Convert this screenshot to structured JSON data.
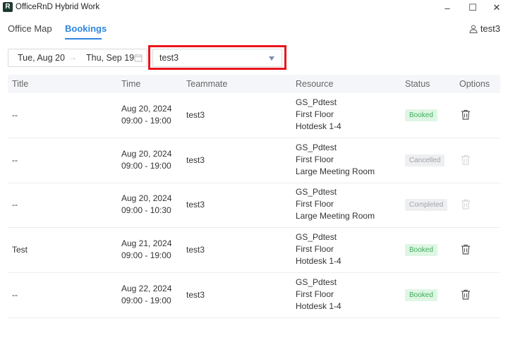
{
  "window": {
    "title": "OfficeRnD Hybrid Work",
    "logo_letter": "R",
    "min_label": "–",
    "max_label": "☐",
    "close_label": "✕"
  },
  "nav": {
    "tabs": [
      "Office Map",
      "Bookings"
    ],
    "active": "Bookings"
  },
  "user": {
    "name": "test3",
    "icon": "user-icon"
  },
  "filters": {
    "date_start": "Tue, Aug 20",
    "date_arrow": "→",
    "date_end": "Thu, Sep 19",
    "teammate_selected": "test3"
  },
  "table": {
    "columns": [
      "Title",
      "Time",
      "Teammate",
      "Resource",
      "Status",
      "Options"
    ],
    "rows": [
      {
        "title": "--",
        "date": "Aug 20, 2024",
        "time": "09:00 - 19:00",
        "teammate": "test3",
        "resource": [
          "GS_Pdtest",
          "First Floor",
          "Hotdesk 1-4"
        ],
        "status": "Booked",
        "delete_enabled": true
      },
      {
        "title": "--",
        "date": "Aug 20, 2024",
        "time": "09:00 - 19:00",
        "teammate": "test3",
        "resource": [
          "GS_Pdtest",
          "First Floor",
          "Large Meeting Room"
        ],
        "status": "Cancelled",
        "delete_enabled": false
      },
      {
        "title": "--",
        "date": "Aug 20, 2024",
        "time": "09:00 - 10:30",
        "teammate": "test3",
        "resource": [
          "GS_Pdtest",
          "First Floor",
          "Large Meeting Room"
        ],
        "status": "Completed",
        "delete_enabled": false
      },
      {
        "title": "Test",
        "date": "Aug 21, 2024",
        "time": "09:00 - 19:00",
        "teammate": "test3",
        "resource": [
          "GS_Pdtest",
          "First Floor",
          "Hotdesk 1-4"
        ],
        "status": "Booked",
        "delete_enabled": true
      },
      {
        "title": "--",
        "date": "Aug 22, 2024",
        "time": "09:00 - 19:00",
        "teammate": "test3",
        "resource": [
          "GS_Pdtest",
          "First Floor",
          "Hotdesk 1-4"
        ],
        "status": "Booked",
        "delete_enabled": true
      }
    ]
  },
  "colors": {
    "accent": "#2e86de",
    "highlight": "#e8141c",
    "booked_bg": "#dff6e4",
    "booked_text": "#3fae5a"
  }
}
